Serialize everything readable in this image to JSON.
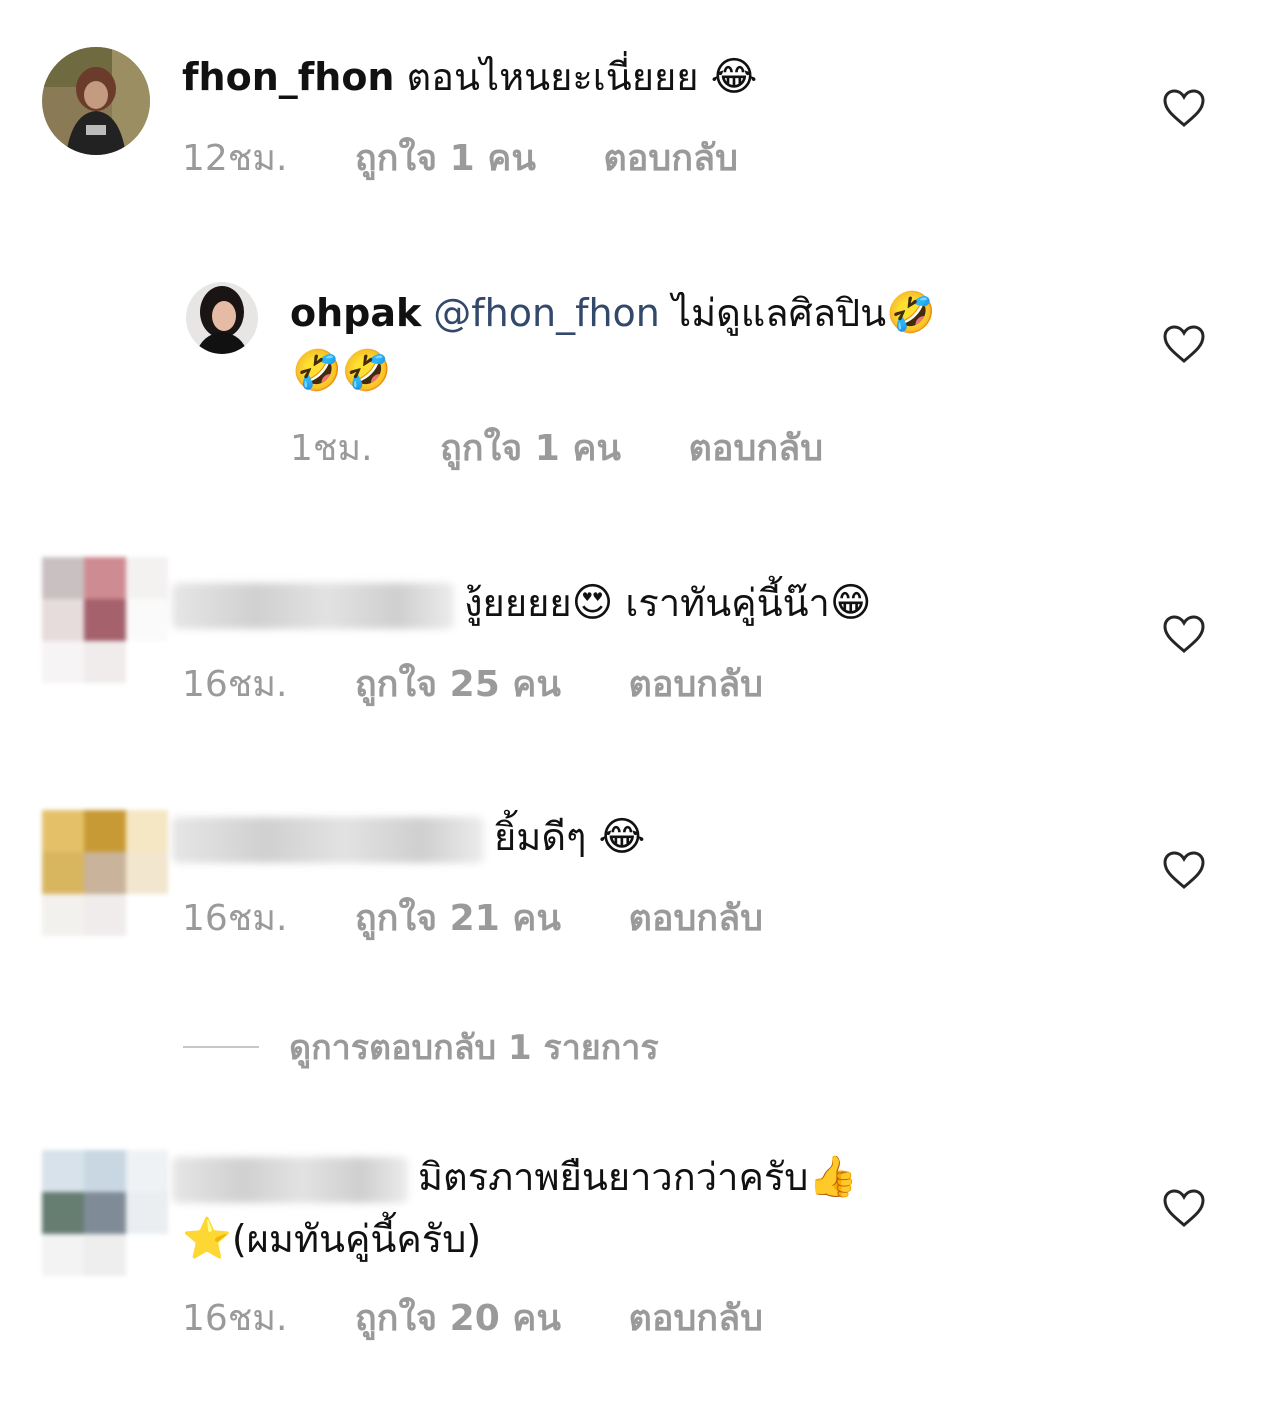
{
  "comments": [
    {
      "username": "fhon_fhon",
      "text": "ตอนไหนยะเนี่ยยย",
      "emoji": "😂",
      "time": "12ชม.",
      "likes": "ถูกใจ 1 คน",
      "reply": "ตอบกลับ"
    },
    {
      "username": "ohpak",
      "mention": "@fhon_fhon",
      "text": "ไม่ดูแลศิลปิน",
      "emoji": "🤣",
      "emoji_line2": "🤣🤣",
      "time": "1ชม.",
      "likes": "ถูกใจ 1 คน",
      "reply": "ตอบกลับ"
    },
    {
      "text": "งู้ยยยย",
      "emoji": "😍",
      "text2": "เราทันคู่นี้น๊า",
      "emoji2": "😁",
      "time": "16ชม.",
      "likes": "ถูกใจ 25 คน",
      "reply": "ตอบกลับ",
      "avatar_colors": [
        "#c9c1c1",
        "#cf8b92",
        "#f4f1f1",
        "#e6dcdc",
        "#a5626d",
        "#fbfafa",
        "#f6f4f4",
        "#f0ecec",
        "#ffffff"
      ]
    },
    {
      "text": "ยิ้มดีๆ",
      "emoji": "😂",
      "time": "16ชม.",
      "likes": "ถูกใจ 21 คน",
      "reply": "ตอบกลับ",
      "view_replies": "ดูการตอบกลับ 1 รายการ",
      "avatar_colors": [
        "#e4c169",
        "#c89a35",
        "#f5e7c4",
        "#d8b660",
        "#c9b39a",
        "#f2e6cf",
        "#f3f1ee",
        "#efeceb",
        "#ffffff"
      ]
    },
    {
      "text": "มิตรภาพยืนยาวกว่าครับ",
      "emoji": "👍",
      "emoji_line2": "⭐",
      "text_line2": "(ผมทันคู่นี้ครับ)",
      "time": "16ชม.",
      "likes": "ถูกใจ 20 คน",
      "reply": "ตอบกลับ",
      "avatar_colors": [
        "#d7e2ea",
        "#c9d7e3",
        "#eef2f5",
        "#667d72",
        "#7f8c98",
        "#eaeef1",
        "#f3f3f3",
        "#eeeeee",
        "#ffffff"
      ]
    }
  ],
  "icons": {
    "like": "heart-outline-icon"
  }
}
